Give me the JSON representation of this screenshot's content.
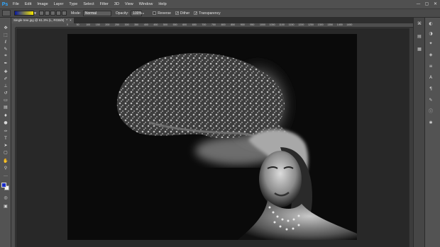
{
  "app": {
    "logo": "Ps"
  },
  "menu": [
    "File",
    "Edit",
    "Image",
    "Layer",
    "Type",
    "Select",
    "Filter",
    "3D",
    "View",
    "Window",
    "Help"
  ],
  "window_controls": [
    "—",
    "▢",
    "✕"
  ],
  "options": {
    "mode_label": "Mode:",
    "mode_value": "Normal",
    "opacity_label": "Opacity:",
    "opacity_value": "100%",
    "reverse_label": "Reverse",
    "dither_label": "Dither",
    "transparency_label": "Transparency",
    "reverse_checked": false,
    "dither_checked": true,
    "transparency_checked": true,
    "gradient_colors": [
      "#0a1aa0",
      "#f5e600"
    ]
  },
  "document": {
    "tab_title": "Single tree.jpg @ 61.3% (L, RGB/8)",
    "tab_modified": "*",
    "tab_close": "×"
  },
  "ruler": {
    "top_ticks": [
      "0",
      "50",
      "100",
      "150",
      "200",
      "250",
      "300",
      "350",
      "400",
      "450",
      "500",
      "550",
      "600",
      "650",
      "700",
      "750",
      "800",
      "850",
      "900",
      "950",
      "1000",
      "1050",
      "1100",
      "1150",
      "1200",
      "1250",
      "1300",
      "1350",
      "1400",
      "1450"
    ]
  },
  "tools": [
    "move-icon",
    "marquee-icon",
    "lasso-icon",
    "quick-select-icon",
    "crop-icon",
    "eyedropper-icon",
    "healing-icon",
    "brush-icon",
    "stamp-icon",
    "history-brush-icon",
    "eraser-icon",
    "gradient-icon",
    "blur-icon",
    "dodge-icon",
    "pen-icon",
    "type-icon",
    "path-select-icon",
    "shape-icon",
    "hand-icon",
    "zoom-icon"
  ],
  "colors": {
    "foreground": "#1a2cc9",
    "background": "#f2f2f2",
    "accent": "#31a8ff"
  }
}
